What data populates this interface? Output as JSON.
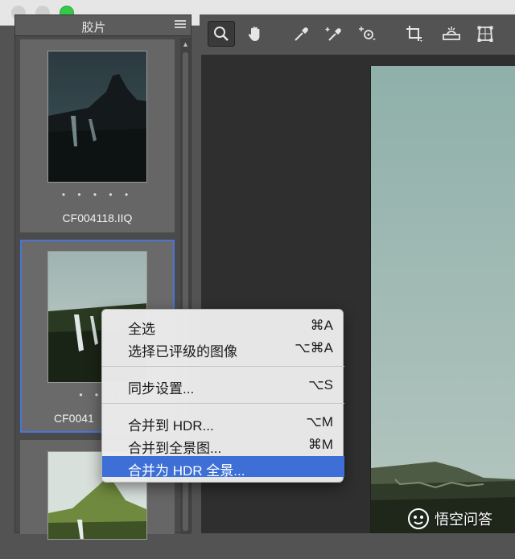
{
  "filmstrip": {
    "title": "胶片",
    "items": [
      {
        "rating_dots": "• • • • •",
        "filename": "CF004118.IIQ"
      },
      {
        "rating_dots": "• • •",
        "filename": "CF0041"
      }
    ]
  },
  "toolbar": {
    "tools": [
      "zoom-tool",
      "hand-tool",
      "white-balance-tool",
      "color-sampler-tool",
      "targeted-adjustment-tool",
      "crop-tool",
      "straighten-tool",
      "transform-tool"
    ]
  },
  "context_menu": {
    "items": [
      {
        "label": "全选",
        "shortcut": "⌘A"
      },
      {
        "label": "选择已评级的图像",
        "shortcut": "⌥⌘A"
      },
      {
        "label": "同步设置...",
        "shortcut": "⌥S"
      },
      {
        "label": "合并到 HDR...",
        "shortcut": "⌥M"
      },
      {
        "label": "合并到全景图...",
        "shortcut": "⌘M"
      },
      {
        "label": "合并为 HDR 全景...",
        "shortcut": ""
      }
    ],
    "highlighted_index": 5,
    "highlight_color": "#3d6fd6"
  },
  "watermark": {
    "text": "悟空问答"
  },
  "colors": {
    "selection_border": "#4b73d8",
    "panel_bg": "#535353"
  }
}
